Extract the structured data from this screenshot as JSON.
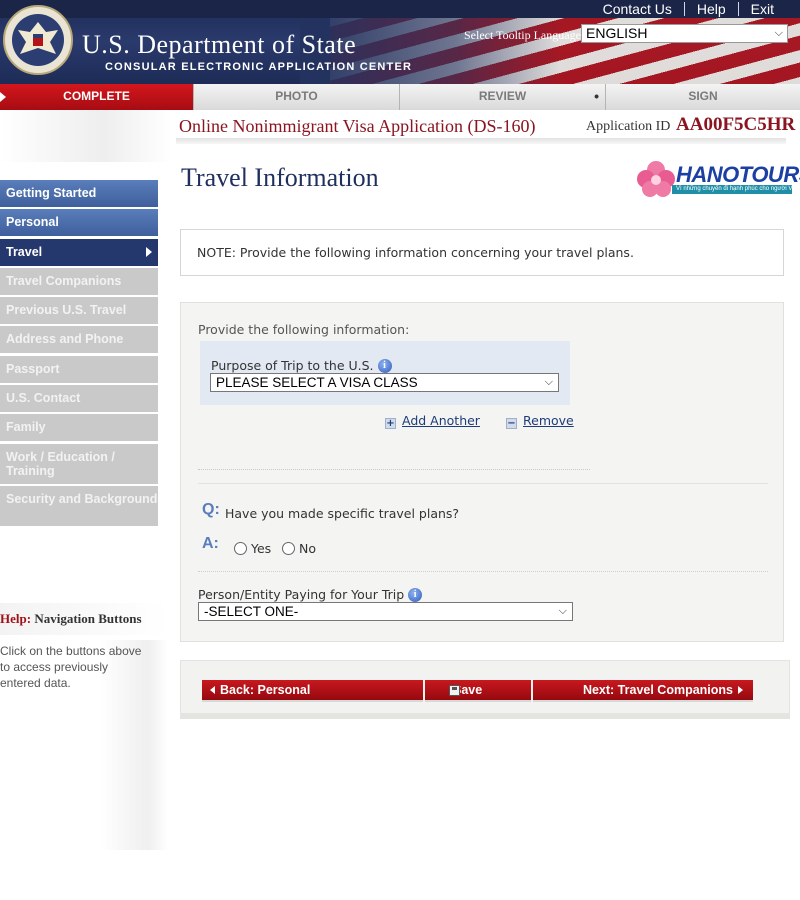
{
  "header": {
    "department_title": "U.S. Department of State",
    "department_subtitle": "CONSULAR ELECTRONIC APPLICATION CENTER",
    "links": [
      "Contact Us",
      "Help",
      "Exit"
    ],
    "tooltip_language_label": "Select Tooltip Language",
    "tooltip_language_value": "ENGLISH"
  },
  "steps": [
    {
      "label": "COMPLETE",
      "active": true
    },
    {
      "label": "PHOTO",
      "active": false
    },
    {
      "label": "REVIEW",
      "active": false
    },
    {
      "label": "SIGN",
      "active": false
    }
  ],
  "application": {
    "form_title": "Online Nonimmigrant Visa Application (DS-160)",
    "id_label": "Application ID",
    "id_value": "AA00F5C5HR"
  },
  "sidebar": {
    "items": [
      {
        "label": "Getting Started",
        "state": "done"
      },
      {
        "label": "Personal",
        "state": "done"
      },
      {
        "label": "Travel",
        "state": "current"
      },
      {
        "label": "Travel Companions",
        "state": "todo"
      },
      {
        "label": "Previous U.S. Travel",
        "state": "todo"
      },
      {
        "label": "Address and Phone",
        "state": "todo"
      },
      {
        "label": "Passport",
        "state": "todo"
      },
      {
        "label": "U.S. Contact",
        "state": "todo"
      },
      {
        "label": "Family",
        "state": "todo"
      },
      {
        "label": "Work / Education / Training",
        "state": "todo"
      },
      {
        "label": "Security and Background",
        "state": "todo"
      }
    ],
    "help": {
      "prefix": "Help:",
      "title": "Navigation Buttons",
      "text": "Click on the buttons above to access previously entered data."
    }
  },
  "main": {
    "page_title": "Travel Information",
    "logo_text": "HANOTOURS",
    "logo_tagline": "Vì những chuyến đi hạnh phúc cho người Việt",
    "note": "NOTE: Provide the following information concerning your travel plans.",
    "provide_label": "Provide the following information:",
    "purpose_label": "Purpose of Trip to the U.S.",
    "purpose_value": "PLEASE SELECT A VISA CLASS",
    "add_another": "Add Another",
    "remove": "Remove",
    "question_mark": "Q:",
    "question": "Have you made specific travel plans?",
    "answer_mark": "A:",
    "yes_label": "Yes",
    "no_label": "No",
    "payer_label": "Person/Entity Paying for Your Trip",
    "payer_value": "-SELECT ONE-"
  },
  "buttons": {
    "back": "Back: Personal",
    "save": "Save",
    "next": "Next: Travel Companions"
  },
  "colors": {
    "brand_red": "#a60c12",
    "nav_blue": "#3e5f9b",
    "nav_current": "#24386e",
    "title_blue": "#1f2f5e"
  }
}
